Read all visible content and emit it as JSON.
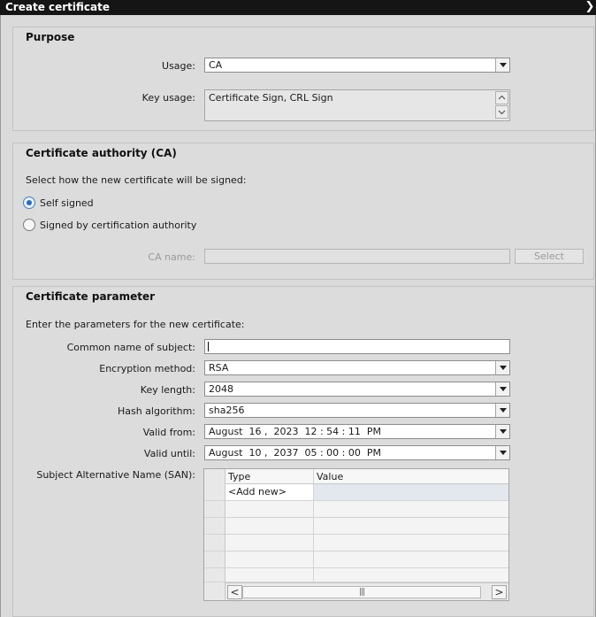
{
  "window": {
    "title": "Create certificate",
    "close_glyph": "❯"
  },
  "purpose": {
    "title": "Purpose",
    "usage_label": "Usage:",
    "usage_value": "CA",
    "key_usage_label": "Key usage:",
    "key_usage_value": "Certificate Sign, CRL Sign"
  },
  "ca": {
    "title": "Certificate authority (CA)",
    "instruction": "Select how the new certificate will be signed:",
    "option_self": "Self signed",
    "option_ca": "Signed by certification authority",
    "selected": "self",
    "ca_name_label": "CA name:",
    "ca_name_value": "",
    "select_button": "Select"
  },
  "params": {
    "title": "Certificate parameter",
    "instruction": "Enter the parameters for the new certificate:",
    "common_name_label": "Common name of subject:",
    "common_name_value": "",
    "encryption_label": "Encryption method:",
    "encryption_value": "RSA",
    "key_length_label": "Key length:",
    "key_length_value": "2048",
    "hash_label": "Hash algorithm:",
    "hash_value": "sha256",
    "valid_from_label": "Valid from:",
    "valid_from_value": "August  16 ,  2023  12 : 54 : 11  PM",
    "valid_until_label": "Valid until:",
    "valid_until_value": "August  10 ,  2037  05 : 00 : 00  PM",
    "san_label": "Subject Alternative Name (SAN):",
    "san_columns": [
      "Type",
      "Value"
    ],
    "san_rows": [
      [
        "<Add new>",
        ""
      ]
    ],
    "scroll_thumb_glyph": "|||"
  }
}
